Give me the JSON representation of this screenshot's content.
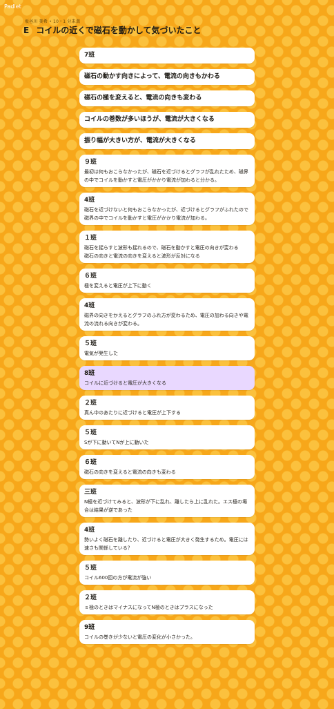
{
  "app": {
    "name": "Padlet"
  },
  "header": {
    "meta": "坂谷川 美希 • 10・1 分未満",
    "section": "E",
    "title": "コイルの近くで磁石を動かして気づいたこと"
  },
  "cards": [
    {
      "title": "7班",
      "body": "",
      "highlight": false
    },
    {
      "title": "磁石の動かす向きによって、電流の向きもかわる",
      "body": "",
      "highlight": false
    },
    {
      "title": "磁石の極を変えると、電流の向きも変わる",
      "body": "",
      "highlight": false
    },
    {
      "title": "コイルの巻数が多いほうが、電流が大きくなる",
      "body": "",
      "highlight": false
    },
    {
      "title": "振り幅が大きい方が、電流が大きくなる",
      "body": "",
      "highlight": false
    },
    {
      "title": "９班",
      "body": "最初は何もおこらなかったが、磁石を近づけるとグラフが乱れたため、磁界の中でコイルを動かすと電圧がかかり電流が加わると分かる。",
      "highlight": false
    },
    {
      "title": "4班",
      "body": "磁石を近づけないと何もおこらなかったが、近づけるとグラフがふれたので磁界の中でコイルを動かすと電圧がかかり電流が加わる。",
      "highlight": false
    },
    {
      "title": "１班",
      "body": "磁石を揺らすと波形も揺れるので、磁石を動かすと電圧の向きが変わる\n磁石の向きと電流の向きを変えると波形が反対になる",
      "highlight": false
    },
    {
      "title": "６班",
      "body": "極を変えると電圧が上下に動く",
      "highlight": false
    },
    {
      "title": "4班",
      "body": "磁界の向きをかえるとグラフのふれ方が変わるため、電圧の加わる向きや電流の流れる向きが変わる。",
      "highlight": false
    },
    {
      "title": "５班",
      "body": "電気が発生した",
      "highlight": false
    },
    {
      "title": "8班",
      "body": "コイルに近づけると電圧が大きくなる",
      "highlight": true
    },
    {
      "title": "２班",
      "body": "真ん中のあたりに近づけると電圧が上下する",
      "highlight": false
    },
    {
      "title": "５班",
      "body": "Sが下に動いてNが上に動いた",
      "highlight": false
    },
    {
      "title": "６班",
      "body": "磁石の向きを変えると電流の向きも変わる",
      "highlight": false
    },
    {
      "title": "三班",
      "body": "N極を近づけてみると、波形が下に乱れ、離したら上に乱れた。エス極の場合は結果が逆であった",
      "highlight": false
    },
    {
      "title": "4班",
      "body": "勢いよく磁石を離したり、近づけると電圧が大きく発生するため。電圧には速さも関係している？",
      "highlight": false
    },
    {
      "title": "５班",
      "body": "コイル600回の方が電流が強い",
      "highlight": false
    },
    {
      "title": "２班",
      "body": "ｓ極のときはマイナスになってN極のときはプラスになった",
      "highlight": false
    },
    {
      "title": "9班",
      "body": "コイルの巻きが少ないと電圧の変化が小さかった。",
      "highlight": false
    }
  ]
}
